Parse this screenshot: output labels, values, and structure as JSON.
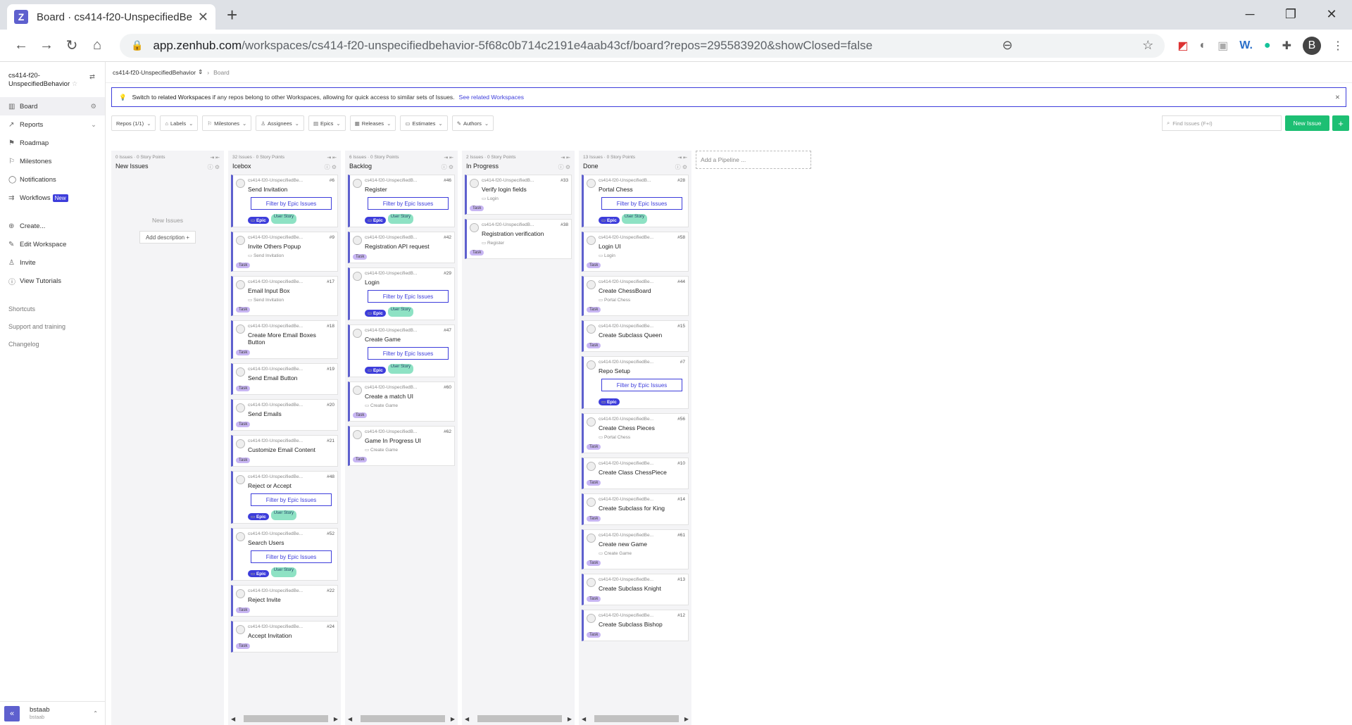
{
  "browser": {
    "tab_title": "Board · cs414-f20-UnspecifiedBe",
    "url_host": "app.zenhub.com",
    "url_path": "/workspaces/cs414-f20-unspecifiedbehavior-5f68c0b714c2191e4aab43cf/board?repos=295583920&showClosed=false",
    "profile_initial": "B"
  },
  "sidebar": {
    "workspace_name": "cs414-f20-UnspecifiedBehavior",
    "nav": [
      {
        "label": "Board"
      },
      {
        "label": "Reports"
      },
      {
        "label": "Roadmap"
      },
      {
        "label": "Milestones"
      },
      {
        "label": "Notifications"
      },
      {
        "label": "Workflows",
        "badge": "New"
      }
    ],
    "actions": [
      {
        "label": "Create..."
      },
      {
        "label": "Edit Workspace"
      },
      {
        "label": "Invite"
      },
      {
        "label": "View Tutorials"
      }
    ],
    "links": [
      "Shortcuts",
      "Support and training",
      "Changelog"
    ],
    "user": {
      "name": "bstaab",
      "handle": "bstaab"
    }
  },
  "breadcrumb": {
    "workspace": "cs414-f20-UnspecifiedBehavior",
    "current": "Board"
  },
  "banner": {
    "bold": "Switch to related Workspaces",
    "text": " if any repos belong to other Workspaces, allowing for quick access to similar sets of Issues.",
    "link": "See related Workspaces"
  },
  "toolbar": {
    "filters": [
      "Repos (1/1)",
      "Labels",
      "Milestones",
      "Assignees",
      "Epics",
      "Releases",
      "Estimates",
      "Authors"
    ],
    "find_placeholder": "Find Issues (F+I)",
    "new_issue": "New Issue",
    "plus": "+"
  },
  "filter_label": "Filter by Epic Issues",
  "add_pipeline": "Add a Pipeline ...",
  "pipelines": [
    {
      "meta": "0 Issues · 0 Story Points",
      "name": "New Issues",
      "empty_text": "New Issues",
      "add_desc": "Add description +",
      "cards": []
    },
    {
      "meta": "32 Issues · 0 Story Points",
      "name": "Icebox",
      "cards": [
        {
          "repo": "cs414-f20-UnspecifiedBe...",
          "num": "#6",
          "title": "Send Invitation",
          "filter": true,
          "tags": [
            "Epic",
            "User Story"
          ]
        },
        {
          "repo": "cs414-f20-UnspecifiedBe...",
          "num": "#9",
          "title": "Invite Others Popup",
          "epic": "Send Invitation",
          "tags": [
            "Task"
          ]
        },
        {
          "repo": "cs414-f20-UnspecifiedBe...",
          "num": "#17",
          "title": "Email Input Box",
          "epic": "Send Invitation",
          "tags": [
            "Task"
          ]
        },
        {
          "repo": "cs414-f20-UnspecifiedBe...",
          "num": "#18",
          "title": "Create More Email Boxes Button",
          "tags": [
            "Task"
          ]
        },
        {
          "repo": "cs414-f20-UnspecifiedBe...",
          "num": "#19",
          "title": "Send Email Button",
          "tags": [
            "Task"
          ]
        },
        {
          "repo": "cs414-f20-UnspecifiedBe...",
          "num": "#20",
          "title": "Send Emails",
          "tags": [
            "Task"
          ]
        },
        {
          "repo": "cs414-f20-UnspecifiedBe...",
          "num": "#21",
          "title": "Customize Email Content",
          "tags": [
            "Task"
          ]
        },
        {
          "repo": "cs414-f20-UnspecifiedBe...",
          "num": "#48",
          "title": "Reject or Accept",
          "filter": true,
          "tags": [
            "Epic",
            "User Story"
          ]
        },
        {
          "repo": "cs414-f20-UnspecifiedBe...",
          "num": "#52",
          "title": "Search Users",
          "filter": true,
          "tags": [
            "Epic",
            "User Story"
          ]
        },
        {
          "repo": "cs414-f20-UnspecifiedBe...",
          "num": "#22",
          "title": "Reject Invite",
          "tags": [
            "Task"
          ]
        },
        {
          "repo": "cs414-f20-UnspecifiedBe...",
          "num": "#24",
          "title": "Accept Invitation",
          "tags": [
            "Task"
          ]
        }
      ]
    },
    {
      "meta": "6 Issues · 0 Story Points",
      "name": "Backlog",
      "cards": [
        {
          "repo": "cs414-f20-UnspecifiedB...",
          "num": "#46",
          "title": "Register",
          "filter": true,
          "tags": [
            "Epic",
            "User Story"
          ]
        },
        {
          "repo": "cs414-f20-UnspecifiedB...",
          "num": "#42",
          "title": "Registration API request",
          "tags": [
            "Task"
          ]
        },
        {
          "repo": "cs414-f20-UnspecifiedB...",
          "num": "#29",
          "title": "Login",
          "filter": true,
          "tags": [
            "Epic",
            "User Story"
          ]
        },
        {
          "repo": "cs414-f20-UnspecifiedB...",
          "num": "#47",
          "title": "Create Game",
          "filter": true,
          "tags": [
            "Epic",
            "User Story"
          ]
        },
        {
          "repo": "cs414-f20-UnspecifiedB...",
          "num": "#60",
          "title": "Create a match UI",
          "epic": "Create Game",
          "tags": [
            "Task"
          ]
        },
        {
          "repo": "cs414-f20-UnspecifiedB...",
          "num": "#62",
          "title": "Game In Progress UI",
          "epic": "Create Game",
          "tags": [
            "Task"
          ]
        }
      ]
    },
    {
      "meta": "2 Issues · 0 Story Points",
      "name": "In Progress",
      "cards": [
        {
          "repo": "cs414-f20-UnspecifiedB...",
          "num": "#33",
          "title": "Verify login fields",
          "epic": "Login",
          "tags": [
            "Task"
          ]
        },
        {
          "repo": "cs414-f20-UnspecifiedB...",
          "num": "#38",
          "title": "Registration verification",
          "epic": "Register",
          "tags": [
            "Task"
          ]
        }
      ]
    },
    {
      "meta": "13 Issues · 0 Story Points",
      "name": "Done",
      "cards": [
        {
          "repo": "cs414-f20-UnspecifiedB...",
          "num": "#28",
          "title": "Portal Chess",
          "filter": true,
          "tags": [
            "Epic",
            "User Story"
          ]
        },
        {
          "repo": "cs414-f20-UnspecifiedBe...",
          "num": "#58",
          "title": "Login UI",
          "epic": "Login",
          "tags": [
            "Task"
          ]
        },
        {
          "repo": "cs414-f20-UnspecifiedBe...",
          "num": "#44",
          "title": "Create ChessBoard",
          "epic": "Portal Chess",
          "tags": [
            "Task"
          ]
        },
        {
          "repo": "cs414-f20-UnspecifiedBe...",
          "num": "#15",
          "title": "Create Subclass Queen",
          "tags": [
            "Task"
          ]
        },
        {
          "repo": "cs414-f20-UnspecifiedBe...",
          "num": "#7",
          "title": "Repo Setup",
          "filter": true,
          "tags": [
            "Epic"
          ]
        },
        {
          "repo": "cs414-f20-UnspecifiedBe...",
          "num": "#56",
          "title": "Create Chess Pieces",
          "epic": "Portal Chess",
          "tags": [
            "Task"
          ]
        },
        {
          "repo": "cs414-f20-UnspecifiedBe...",
          "num": "#10",
          "title": "Create Class ChessPiece",
          "tags": [
            "Task"
          ]
        },
        {
          "repo": "cs414-f20-UnspecifiedBe...",
          "num": "#14",
          "title": "Create Subclass for King",
          "tags": [
            "Task"
          ]
        },
        {
          "repo": "cs414-f20-UnspecifiedBe...",
          "num": "#61",
          "title": "Create new Game",
          "epic": "Create Game",
          "tags": [
            "Task"
          ]
        },
        {
          "repo": "cs414-f20-UnspecifiedBe...",
          "num": "#13",
          "title": "Create Subclass Knight",
          "tags": [
            "Task"
          ]
        },
        {
          "repo": "cs414-f20-UnspecifiedBe...",
          "num": "#12",
          "title": "Create Subclass Bishop",
          "tags": [
            "Task"
          ]
        }
      ]
    }
  ]
}
